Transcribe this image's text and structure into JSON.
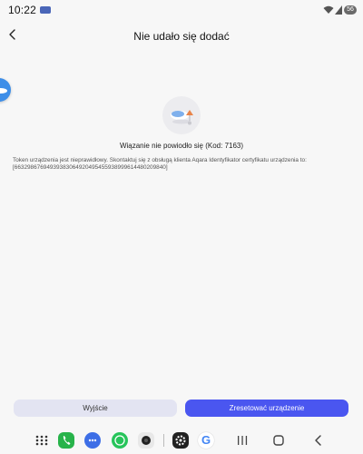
{
  "status_bar": {
    "time": "10:22",
    "battery": "56",
    "icons": [
      "app-notification-icon",
      "wifi-icon",
      "signal-icon",
      "battery-icon"
    ]
  },
  "header": {
    "back_icon": "back-arrow-icon",
    "title": "Nie udało się dodać"
  },
  "main": {
    "illustration_icon": "cloud-device-illustration",
    "error_title": "Wiązanie nie powiodło się (Kod: 7163)",
    "error_message": "Token urządzenia jest nieprawidłowy. Skontaktuj się z obsługą klienta Aqara Identyfikator certyfikatu urządzenia to:",
    "device_certificate_id": "[66329867694939383064920495455938999614480209840]"
  },
  "buttons": {
    "exit_label": "Wyjście",
    "reset_label": "Zresetować urządzenie"
  },
  "dock": {
    "items": [
      "apps-grid-icon",
      "phone-app-icon",
      "messages-app-icon",
      "whatsapp-app-icon",
      "camera-app-icon",
      "settings-app-icon",
      "google-app-icon"
    ],
    "google_letter": "G",
    "nav": [
      "recents-icon",
      "home-icon",
      "back-icon"
    ]
  },
  "colors": {
    "background": "#f7f7f7",
    "primary_button": "#4a56f0",
    "secondary_button": "#e3e4f2"
  }
}
